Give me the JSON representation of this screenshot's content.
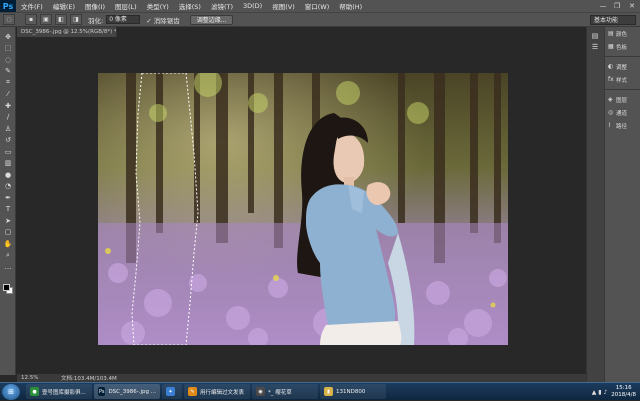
{
  "app": {
    "logo": "Ps"
  },
  "menu": [
    "文件(F)",
    "编辑(E)",
    "图像(I)",
    "图层(L)",
    "类型(Y)",
    "选择(S)",
    "滤镜(T)",
    "3D(D)",
    "视图(V)",
    "窗口(W)",
    "帮助(H)"
  ],
  "window_controls": {
    "minimize": "—",
    "restore": "❐",
    "close": "✕"
  },
  "options": {
    "feather_label": "羽化:",
    "feather_value": "0 像素",
    "antialias_label": "消除锯齿",
    "refine_edge_label": "调整边缘...",
    "workspace": "基本功能"
  },
  "document": {
    "tab_title": "DSC_3986-.jpg @ 12.5%(RGB/8*) * ×",
    "zoom": "12.5%",
    "doc_info": "文档:103.4M/103.4M"
  },
  "tools": [
    "move-icon",
    "marquee-icon",
    "lasso-icon",
    "quick-select-icon",
    "crop-icon",
    "eyedropper-icon",
    "healing-icon",
    "brush-icon",
    "clone-stamp-icon",
    "history-brush-icon",
    "eraser-icon",
    "gradient-icon",
    "blur-icon",
    "dodge-icon",
    "pen-icon",
    "type-icon",
    "path-select-icon",
    "shape-icon",
    "hand-icon",
    "zoom-icon",
    "more-icon"
  ],
  "panels": {
    "group1": [
      {
        "icon": "▤",
        "label": "颜色"
      },
      {
        "icon": "▦",
        "label": "色板"
      }
    ],
    "group2": [
      {
        "icon": "◐",
        "label": "调整"
      },
      {
        "icon": "fx",
        "label": "样式"
      }
    ],
    "group3": [
      {
        "icon": "◈",
        "label": "图层"
      },
      {
        "icon": "◎",
        "label": "通道"
      },
      {
        "icon": "⌇",
        "label": "路径"
      }
    ]
  },
  "taskbar": {
    "items": [
      {
        "label": "壹号图库摄影俱...",
        "color": "#2a8f3a",
        "icon": "●"
      },
      {
        "label": "DSC_3986-.jpg ...",
        "color": "#001e36",
        "icon": "Ps"
      },
      {
        "label": "",
        "color": "#3b7fd4",
        "icon": "✦"
      },
      {
        "label": "用行编辑过文发表",
        "color": "#e08a1a",
        "icon": "✎"
      },
      {
        "label": "*_ 缨花草",
        "color": "#4a4a4a",
        "icon": "◉"
      },
      {
        "label": "131ND800",
        "color": "#d8b34a",
        "icon": "▮"
      }
    ],
    "time": "15:16",
    "date": "2018/4/8"
  }
}
